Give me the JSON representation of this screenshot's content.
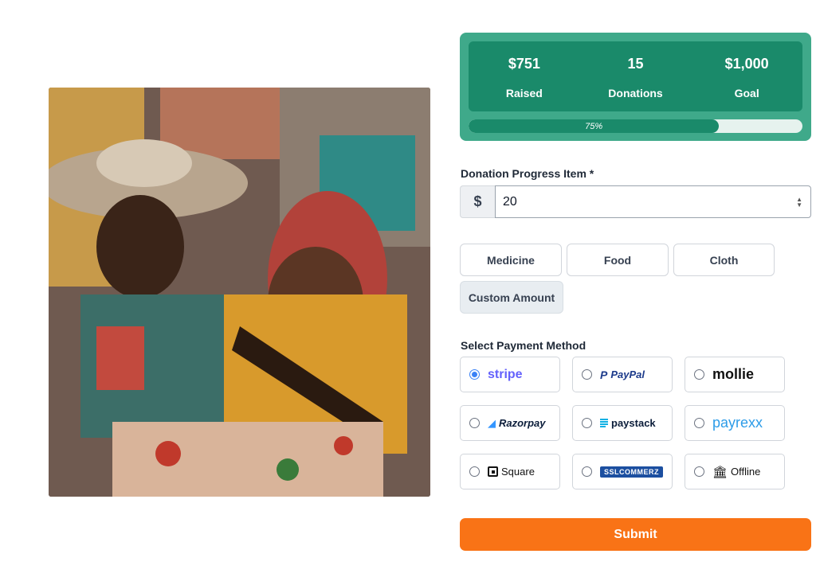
{
  "stats": {
    "raised_value": "$751",
    "raised_label": "Raised",
    "donations_value": "15",
    "donations_label": "Donations",
    "goal_value": "$1,000",
    "goal_label": "Goal",
    "progress_percent": 75,
    "progress_text": "75%"
  },
  "form": {
    "amount_label": "Donation Progress Item *",
    "currency_symbol": "$",
    "amount_value": "20",
    "presets": [
      "Medicine",
      "Food",
      "Cloth",
      "Custom Amount"
    ],
    "payment_label": "Select Payment Method",
    "payment_methods": [
      "stripe",
      "PayPal",
      "mollie",
      "Razorpay",
      "paystack",
      "payrexx",
      "Square",
      "SSLCOMMERZ",
      "Offline"
    ],
    "selected_payment": "stripe",
    "submit_label": "Submit"
  },
  "colors": {
    "accent_green": "#1a8a6a",
    "card_green": "#3fa98a",
    "submit_orange": "#f97316",
    "radio_blue": "#3b82f6"
  },
  "icons": [
    "currency-icon",
    "stepper-icon",
    "paypal-icon",
    "razorpay-icon",
    "paystack-icon",
    "square-icon",
    "bank-icon"
  ]
}
